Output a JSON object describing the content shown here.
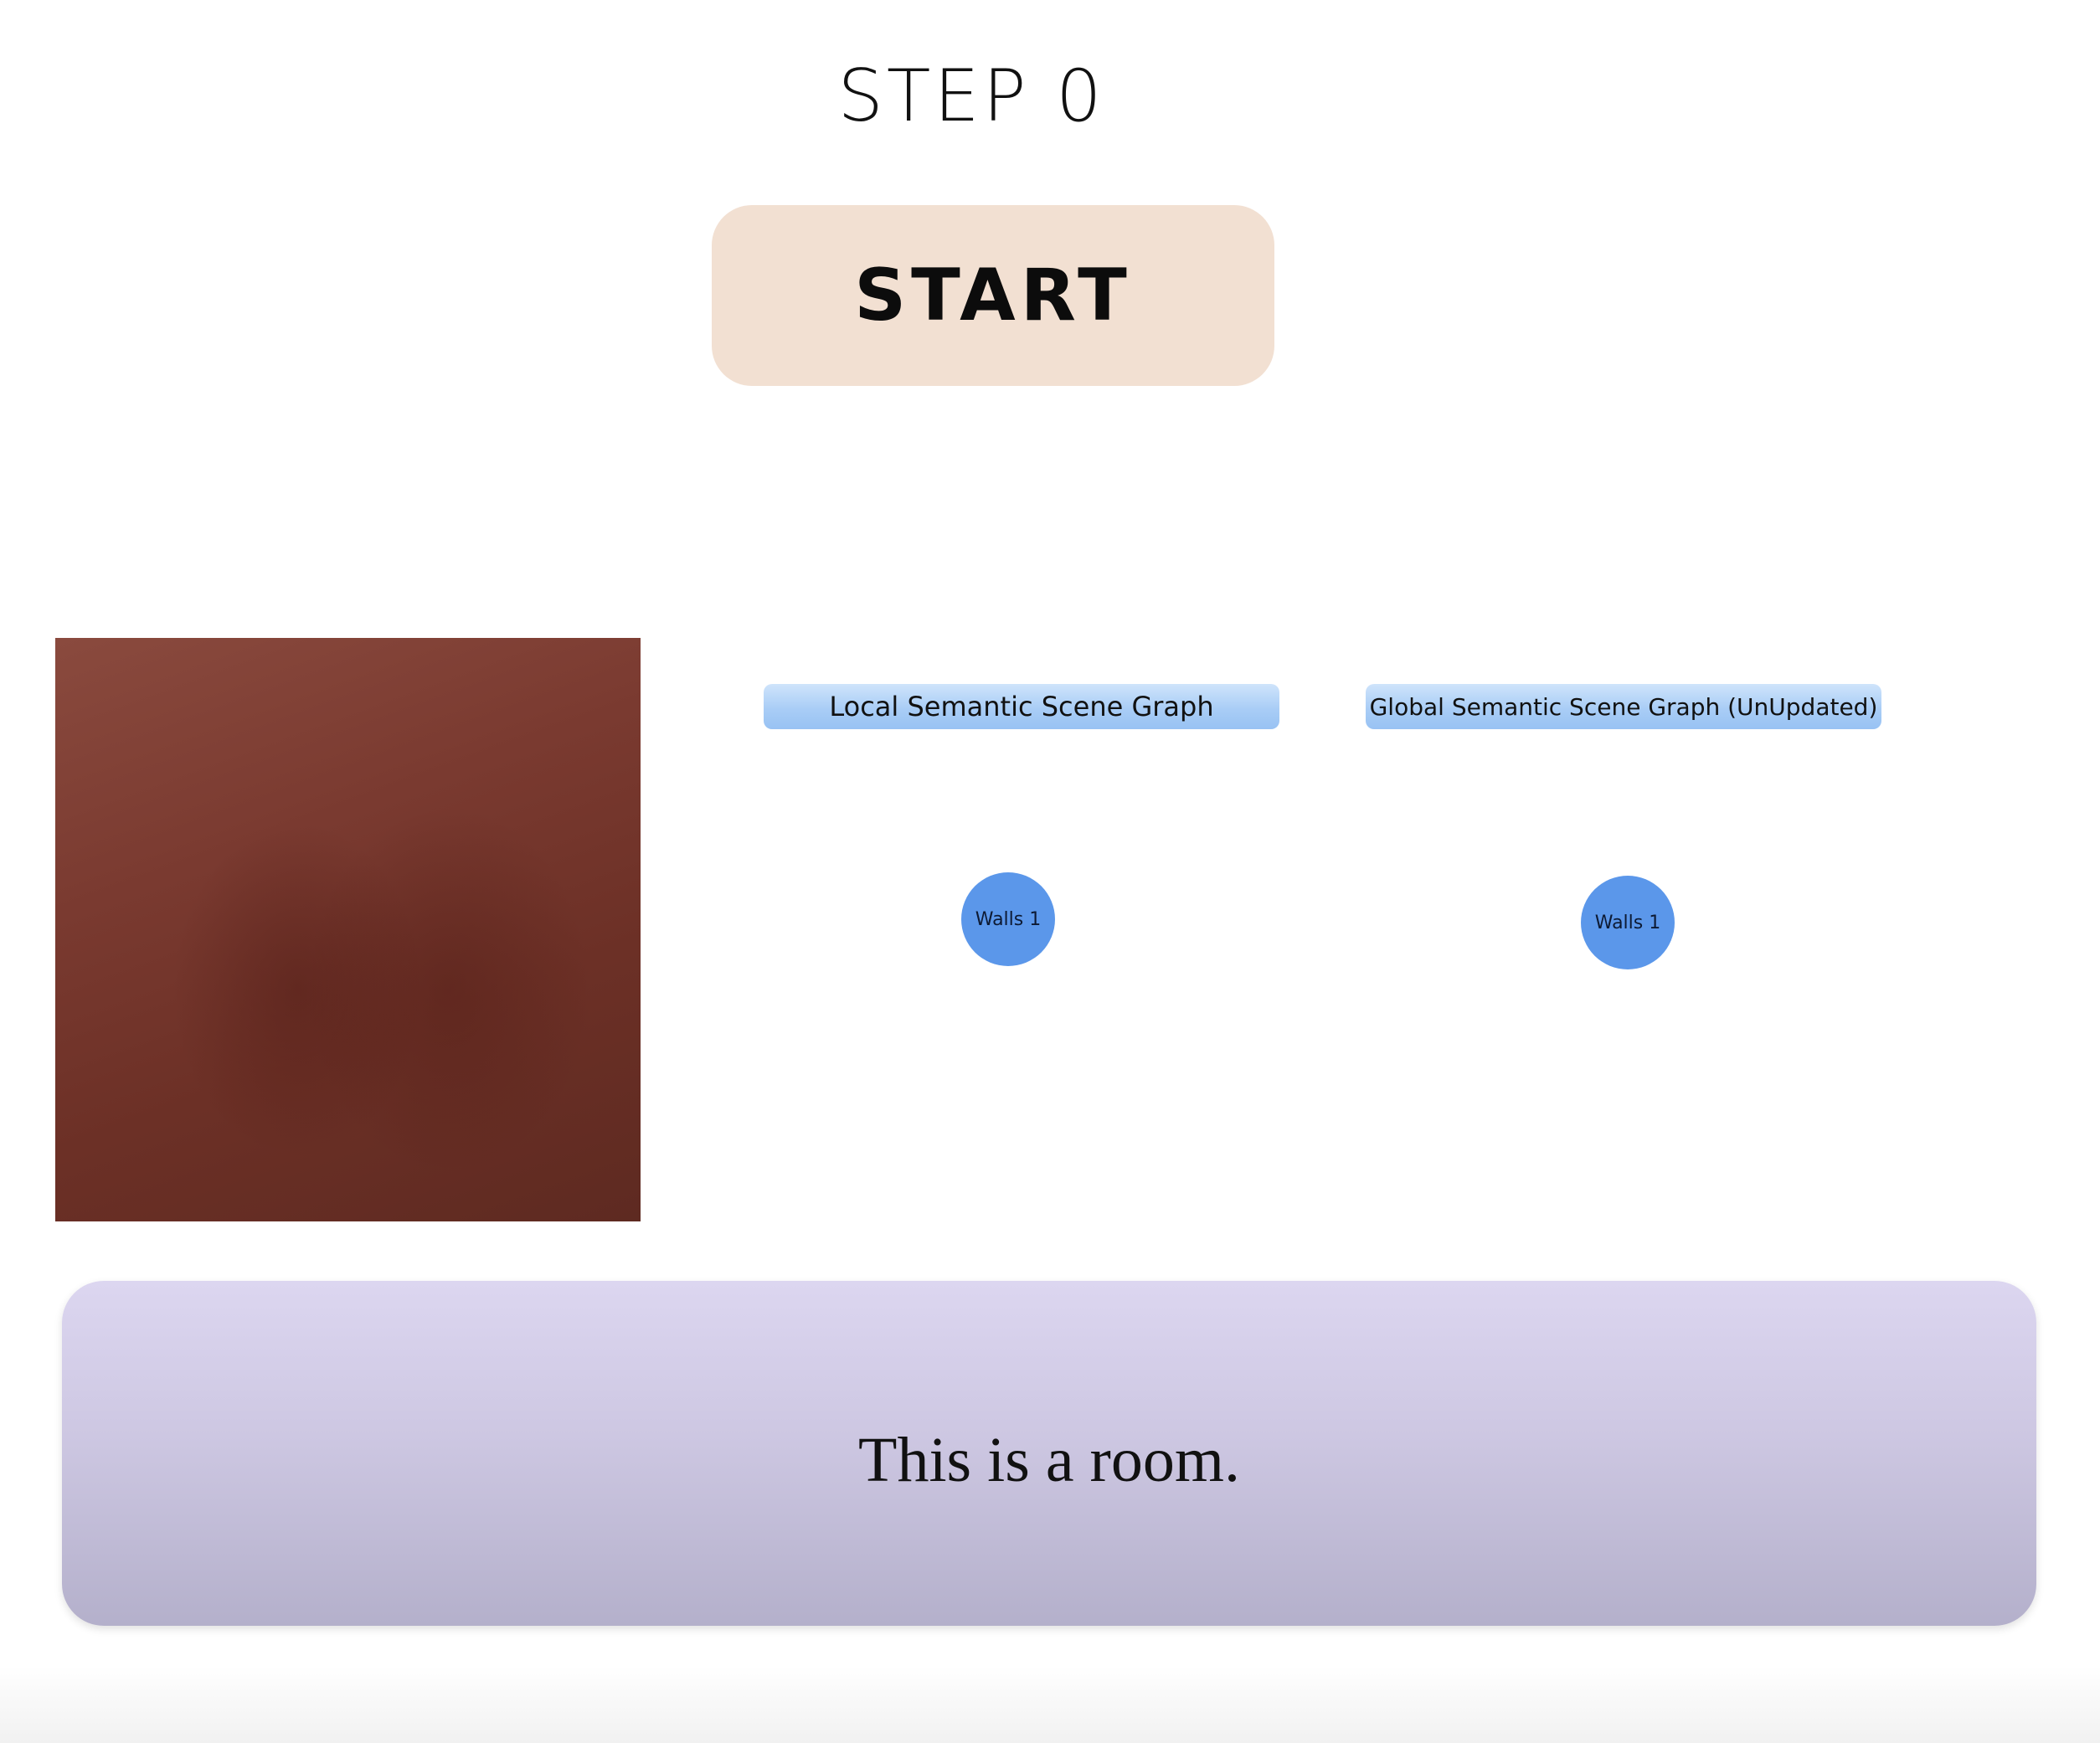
{
  "step": {
    "label": "STEP 0"
  },
  "controls": {
    "start_label": "START"
  },
  "camera": {
    "dominant_color": "#7a3a30"
  },
  "local_graph": {
    "title": "Local Semantic Scene Graph",
    "nodes": [
      {
        "label": "Walls 1",
        "color": "#5b97ea"
      }
    ]
  },
  "global_graph": {
    "title": "Global Semantic Scene Graph (UnUpdated)",
    "nodes": [
      {
        "label": "Walls 1",
        "color": "#5b97ea"
      }
    ]
  },
  "caption": {
    "text": "This is a room."
  },
  "colors": {
    "start_button_bg": "#f2e0d2",
    "header_bg": "#a9cdf6",
    "caption_panel_bg": "#cdc7e2"
  }
}
